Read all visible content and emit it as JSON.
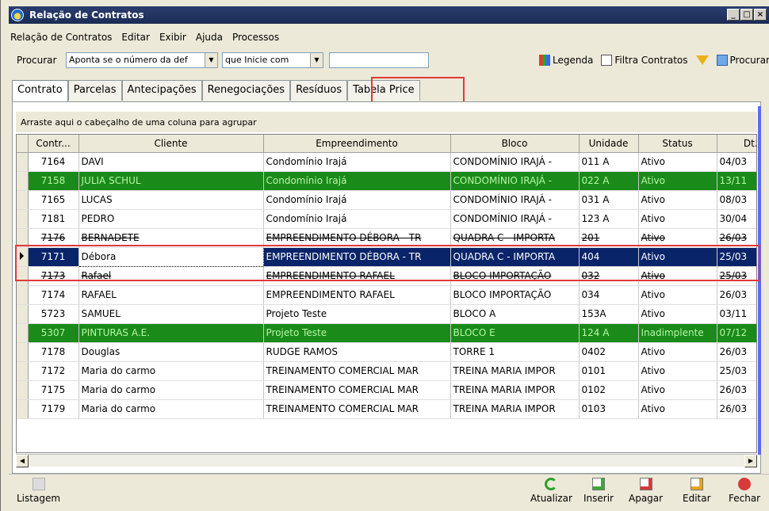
{
  "window": {
    "title": "Relação de Contratos"
  },
  "menu": [
    "Relação de Contratos",
    "Editar",
    "Exibir",
    "Ajuda",
    "Processos"
  ],
  "search": {
    "label": "Procurar",
    "field_value": "Aponta se o número da def",
    "mode_value": "que Inicie com",
    "text_value": ""
  },
  "toolbar": {
    "legend": "Legenda",
    "filter": "Filtra Contratos",
    "search": "Procurar"
  },
  "tabs": [
    "Contrato",
    "Parcelas",
    "Antecipações",
    "Renegociações",
    "Resíduos",
    "Tabela Price"
  ],
  "group_hint": "Arraste aqui o cabeçalho de uma coluna para agrupar",
  "columns": [
    "Contr...",
    "Cliente",
    "Empreendimento",
    "Bloco",
    "Unidade",
    "Status",
    "Dt. S"
  ],
  "rows": [
    {
      "id": "7164",
      "cliente": "DAVI",
      "emp": "Condomínio Irajá",
      "bloco": "CONDOMÍNIO IRAJÁ -",
      "unidade": "011 A",
      "status": "Ativo",
      "dt": "04/03"
    },
    {
      "id": "7158",
      "cliente": "JULIA SCHUL",
      "emp": "Condomínio Irajá",
      "bloco": "CONDOMÍNIO IRAJÁ -",
      "unidade": "022 A",
      "status": "Ativo",
      "dt": "13/11"
    },
    {
      "id": "7165",
      "cliente": "LUCAS",
      "emp": "Condomínio Irajá",
      "bloco": "CONDOMÍNIO IRAJÁ -",
      "unidade": "031 A",
      "status": "Ativo",
      "dt": "08/03"
    },
    {
      "id": "7181",
      "cliente": "PEDRO",
      "emp": "Condomínio Irajá",
      "bloco": "CONDOMÍNIO IRAJÁ -",
      "unidade": "123 A",
      "status": "Ativo",
      "dt": "30/04"
    },
    {
      "id": "7176",
      "cliente": "BERNADETE",
      "emp": "EMPREENDIMENTO DÉBORA - TR",
      "bloco": "QUADRA C - IMPORTA",
      "unidade": "201",
      "status": "Ativo",
      "dt": "26/03"
    },
    {
      "id": "7171",
      "cliente": "Débora",
      "emp": "EMPREENDIMENTO DÉBORA - TR",
      "bloco": "QUADRA C - IMPORTA",
      "unidade": "404",
      "status": "Ativo",
      "dt": "25/03"
    },
    {
      "id": "7173",
      "cliente": "Rafael",
      "emp": "EMPREENDIMENTO RAFAEL",
      "bloco": "BLOCO IMPORTAÇÃO",
      "unidade": "032",
      "status": "Ativo",
      "dt": "25/03"
    },
    {
      "id": "7174",
      "cliente": "RAFAEL",
      "emp": "EMPREENDIMENTO RAFAEL",
      "bloco": "BLOCO IMPORTAÇÃO",
      "unidade": "034",
      "status": "Ativo",
      "dt": "26/03"
    },
    {
      "id": "5723",
      "cliente": "SAMUEL",
      "emp": "Projeto Teste",
      "bloco": "BLOCO A",
      "unidade": "153A",
      "status": "Ativo",
      "dt": "03/11"
    },
    {
      "id": "5307",
      "cliente": "PINTURAS A.E.",
      "emp": "Projeto Teste",
      "bloco": "BLOCO E",
      "unidade": "124 A",
      "status": "Inadimplente",
      "dt": "07/12"
    },
    {
      "id": "7178",
      "cliente": "Douglas",
      "emp": "RUDGE RAMOS",
      "bloco": "TORRE 1",
      "unidade": "0402",
      "status": "Ativo",
      "dt": "26/03"
    },
    {
      "id": "7172",
      "cliente": "Maria do carmo",
      "emp": "TREINAMENTO COMERCIAL MAR",
      "bloco": "TREINA MARIA IMPOR",
      "unidade": "0101",
      "status": "Ativo",
      "dt": "25/03"
    },
    {
      "id": "7175",
      "cliente": "Maria do carmo",
      "emp": "TREINAMENTO COMERCIAL MAR",
      "bloco": "TREINA MARIA IMPOR",
      "unidade": "0102",
      "status": "Ativo",
      "dt": "26/03"
    },
    {
      "id": "7179",
      "cliente": "Maria do carmo",
      "emp": "TREINAMENTO COMERCIAL MAR",
      "bloco": "TREINA MARIA IMPOR",
      "unidade": "0103",
      "status": "Ativo",
      "dt": "26/03"
    }
  ],
  "row_styles": {
    "green_rows": [
      1,
      9
    ],
    "selected_row": 5,
    "strike_rows": [
      4,
      6
    ]
  },
  "bottom": {
    "listagem": "Listagem",
    "atualizar": "Atualizar",
    "inserir": "Inserir",
    "apagar": "Apagar",
    "editar": "Editar",
    "fechar": "Fechar"
  },
  "colors": {
    "green": "#1a8a1a",
    "selected": "#0a246a",
    "highlight": "#e03a3a"
  }
}
